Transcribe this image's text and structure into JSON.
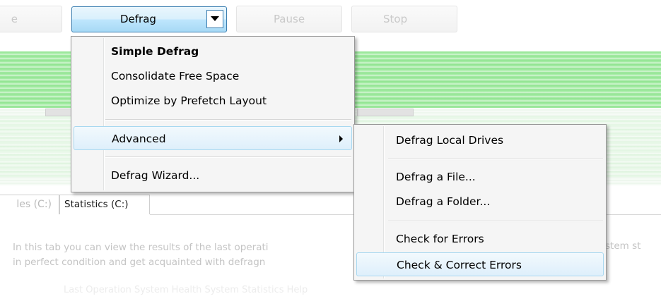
{
  "toolbar": {
    "analyze_label": "e",
    "defrag_label": "Defrag",
    "pause_label": "Pause",
    "stop_label": "Stop"
  },
  "defrag_menu": {
    "items": [
      {
        "label": "Simple Defrag"
      },
      {
        "label": "Consolidate Free Space"
      },
      {
        "label": "Optimize by Prefetch Layout"
      },
      {
        "label": "Advanced"
      },
      {
        "label": "Defrag Wizard..."
      }
    ]
  },
  "advanced_menu": {
    "items": [
      {
        "label": "Defrag Local Drives"
      },
      {
        "label": "Defrag a File..."
      },
      {
        "label": "Defrag a Folder..."
      },
      {
        "label": "Check for Errors"
      },
      {
        "label": "Check & Correct Errors"
      }
    ]
  },
  "tabs": [
    {
      "label": "les (C:)"
    },
    {
      "label": "Statistics (C:)"
    }
  ],
  "statistics": {
    "line1": "In this tab you can view the results of the last operati",
    "line2": "in perfect condition and get acquainted with defragn",
    "line1_tail": "ystem st",
    "faint_links": "Last Operation  System Health  System Statistics  Help"
  },
  "colors": {
    "accent": "#3c7fb1",
    "highlight": "#deeffb",
    "disk_green": "#7ee07e"
  }
}
